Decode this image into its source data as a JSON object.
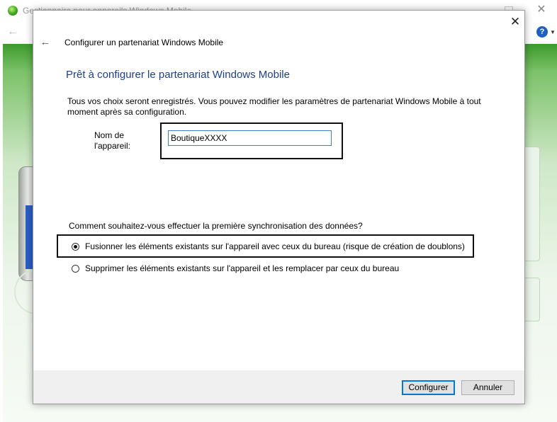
{
  "background_window": {
    "title": "Gestionnaire pour appareils Windows Mobile",
    "help_icon": "help-icon",
    "colors": {
      "green": "#3c9a2c"
    }
  },
  "dialog": {
    "header": "Configurer un partenariat Windows Mobile",
    "heading": "Prêt à configurer le partenariat Windows Mobile",
    "description": "Tous vos choix seront enregistrés. Vous pouvez modifier les paramètres de partenariat Windows Mobile à tout moment après sa configuration.",
    "device_name_label": "Nom de l'appareil:",
    "device_name_value": "BoutiqueXXXX",
    "sync_question": "Comment souhaitez-vous effectuer la première synchronisation des données?",
    "options": [
      {
        "label": "Fusionner les éléments existants sur l'appareil avec ceux du bureau (risque de création de doublons)",
        "checked": true
      },
      {
        "label": "Supprimer les éléments existants sur l'appareil et les remplacer par ceux du bureau",
        "checked": false
      }
    ],
    "buttons": {
      "configure": "Configurer",
      "cancel": "Annuler"
    },
    "colors": {
      "heading": "#1e3f8a",
      "input_border": "#3b7fc7",
      "default_button": "#0078d7"
    }
  }
}
